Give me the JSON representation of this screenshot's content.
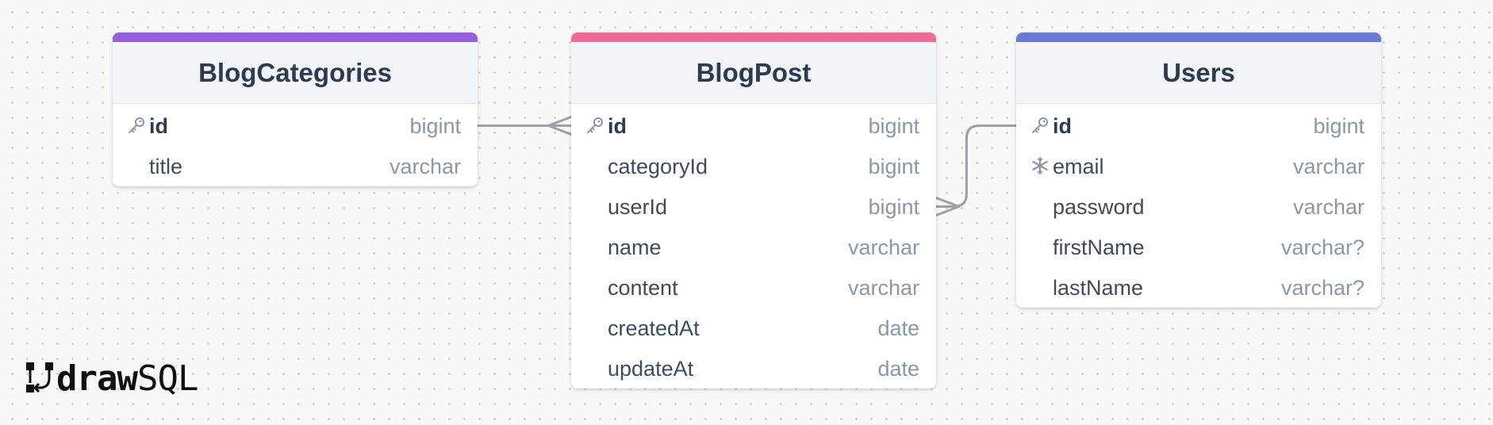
{
  "tables": [
    {
      "name": "BlogCategories",
      "accent": "#9560e0",
      "fields": [
        {
          "name": "id",
          "type": "bigint",
          "icon": "key-icon"
        },
        {
          "name": "title",
          "type": "varchar",
          "icon": ""
        }
      ]
    },
    {
      "name": "BlogPost",
      "accent": "#ef6b96",
      "fields": [
        {
          "name": "id",
          "type": "bigint",
          "icon": "key-icon"
        },
        {
          "name": "categoryId",
          "type": "bigint",
          "icon": ""
        },
        {
          "name": "userId",
          "type": "bigint",
          "icon": ""
        },
        {
          "name": "name",
          "type": "varchar",
          "icon": ""
        },
        {
          "name": "content",
          "type": "varchar",
          "icon": ""
        },
        {
          "name": "createdAt",
          "type": "date",
          "icon": ""
        },
        {
          "name": "updateAt",
          "type": "date",
          "icon": ""
        }
      ]
    },
    {
      "name": "Users",
      "accent": "#6b78d6",
      "fields": [
        {
          "name": "id",
          "type": "bigint",
          "icon": "key-icon"
        },
        {
          "name": "email",
          "type": "varchar",
          "icon": "unique-index-icon"
        },
        {
          "name": "password",
          "type": "varchar",
          "icon": ""
        },
        {
          "name": "firstName",
          "type": "varchar?",
          "icon": ""
        },
        {
          "name": "lastName",
          "type": "varchar?",
          "icon": ""
        }
      ]
    }
  ],
  "relations": [
    {
      "from_table": 0,
      "from_field": 0,
      "to_table": 1,
      "to_field": 0,
      "to_end": "many"
    },
    {
      "from_table": 2,
      "from_field": 0,
      "to_table": 1,
      "to_field": 2,
      "to_end": "many"
    }
  ],
  "logo": {
    "bold": "draw",
    "light": "SQL"
  },
  "colors": {
    "connector": "#9ea0a3",
    "background": "#f8f8f7"
  }
}
